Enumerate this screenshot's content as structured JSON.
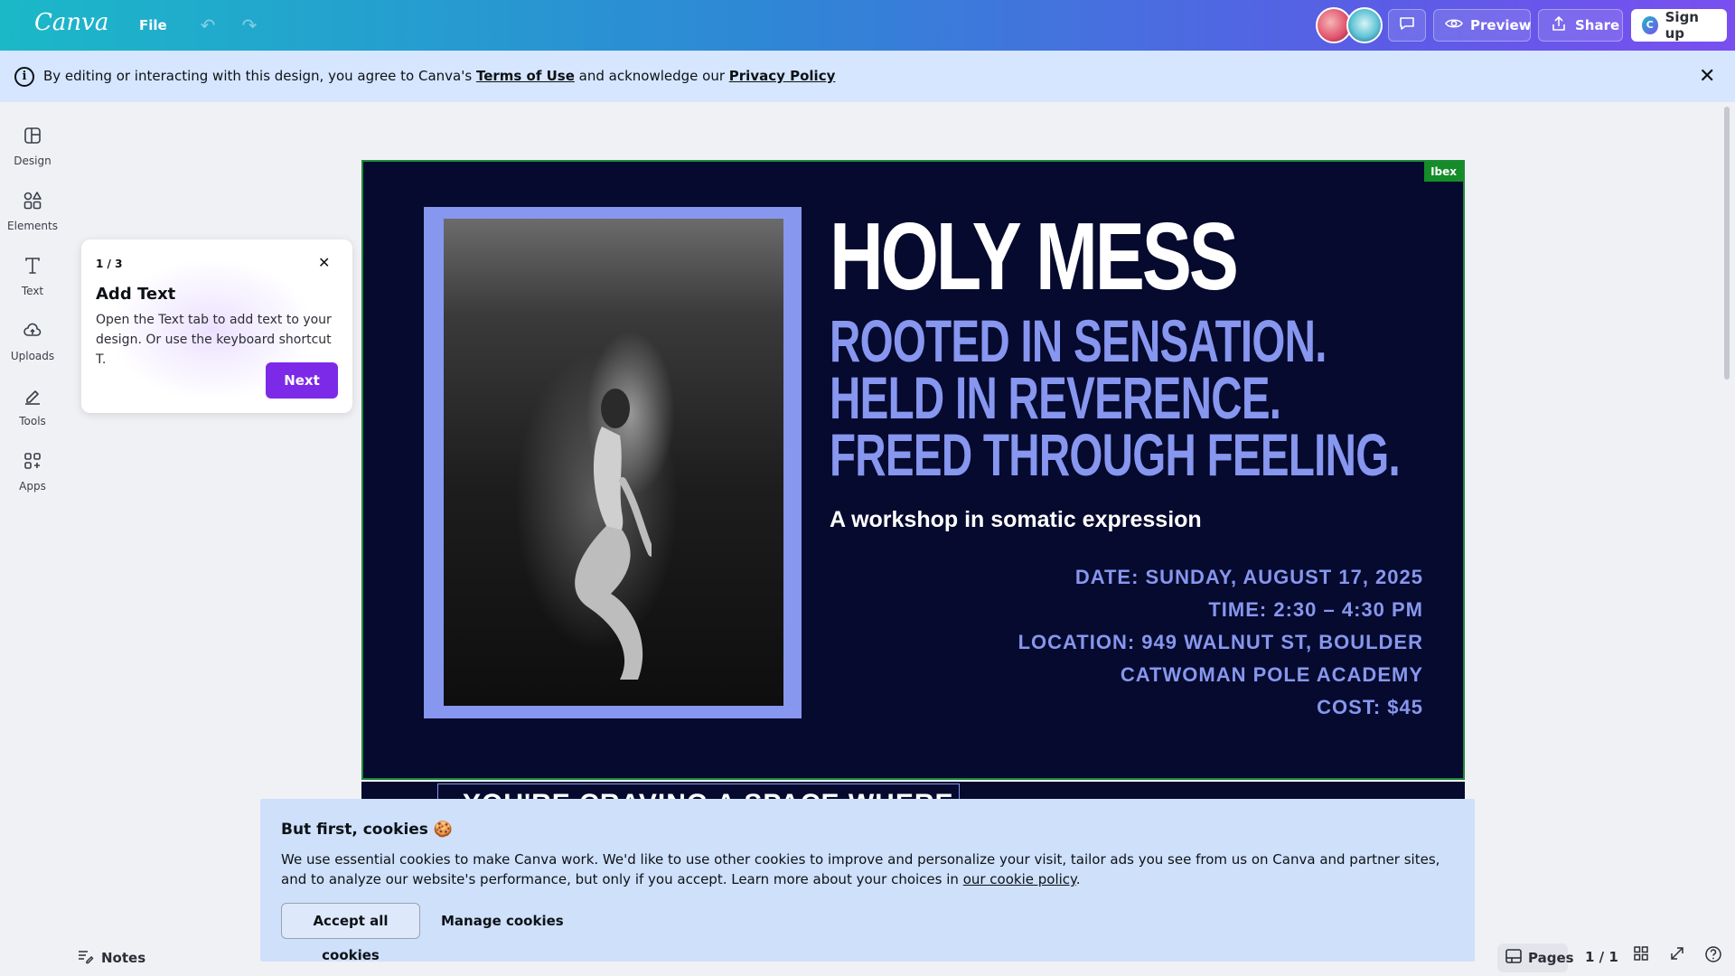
{
  "topbar": {
    "logo": "Canva",
    "file_label": "File",
    "preview_label": "Preview",
    "share_label": "Share",
    "signup_label": "Sign up",
    "signup_badge": "C"
  },
  "notice": {
    "prefix": "By editing or interacting with this design, you agree to Canva's ",
    "terms": "Terms of Use",
    "middle": " and acknowledge our ",
    "privacy": "Privacy Policy"
  },
  "rail": {
    "items": [
      {
        "label": "Design",
        "icon": "design-icon"
      },
      {
        "label": "Elements",
        "icon": "elements-icon"
      },
      {
        "label": "Text",
        "icon": "text-icon"
      },
      {
        "label": "Uploads",
        "icon": "uploads-icon"
      },
      {
        "label": "Tools",
        "icon": "tools-icon"
      },
      {
        "label": "Apps",
        "icon": "apps-icon"
      }
    ]
  },
  "popover": {
    "step": "1 / 3",
    "title": "Add Text",
    "body": "Open the Text tab to add text to your design. Or use the keyboard shortcut T.",
    "next_label": "Next"
  },
  "design": {
    "badge": "Ibex",
    "headline": "HOLY MESS",
    "tagline": [
      "ROOTED IN SENSATION.",
      "HELD IN REVERENCE.",
      "FREED THROUGH FEELING."
    ],
    "subtitle": "A workshop in somatic expression",
    "details": [
      "DATE: SUNDAY, AUGUST 17, 2025",
      "TIME: 2:30 – 4:30 PM",
      "LOCATION: 949 WALNUT ST,  BOULDER",
      "CATWOMAN POLE ACADEMY",
      "COST: $45"
    ],
    "page2_partial": "YOU'RE CRAVING A SPACE WHERE",
    "colors": {
      "background": "#050a2e",
      "accent": "#8796ee",
      "selection": "#1e8a3a"
    }
  },
  "cookie": {
    "title": "But first, cookies 🍪",
    "body_prefix": "We use essential cookies to make Canva work. We'd like to use other cookies to improve and personalize your visit, tailor ads you see from us on Canva and partner sites, and to analyze our website's performance, but only if you accept. Learn more about your choices in ",
    "link": "our cookie policy",
    "body_suffix": ".",
    "accept_label": "Accept all cookies",
    "manage_label": "Manage cookies"
  },
  "bottombar": {
    "notes_label": "Notes",
    "pages_label": "Pages",
    "page_count": "1 / 1"
  }
}
